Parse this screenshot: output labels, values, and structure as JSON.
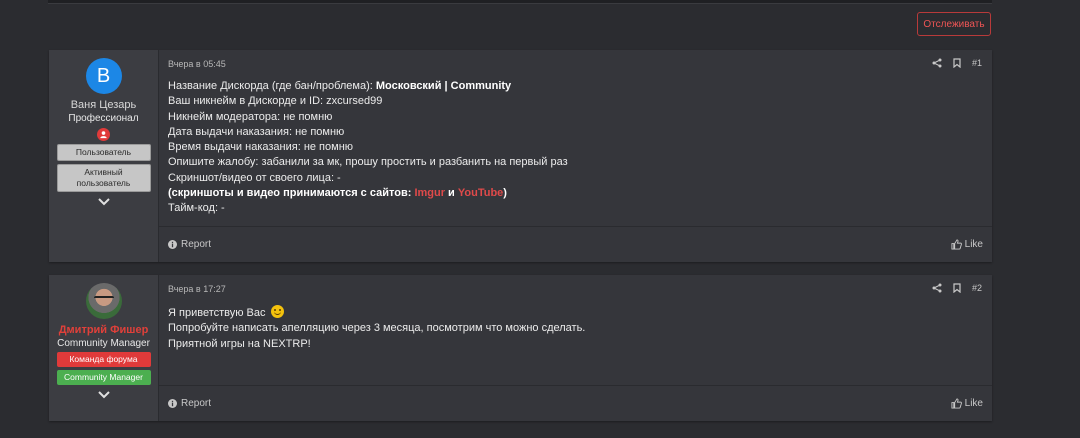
{
  "thread": {
    "watch_label": "Отслеживать"
  },
  "posts": [
    {
      "user": {
        "avatar_letter": "B",
        "name": "Ваня Цезарь",
        "title": "Профессионал",
        "badges": [
          "Пользователь",
          "Активный пользователь"
        ]
      },
      "date": "Вчера в 05:45",
      "number": "#1",
      "lines": [
        {
          "label": "Название Дискорда (где бан/проблема): ",
          "value": "Московский | Community"
        },
        {
          "text": "Ваш никнейм в Дискорде и ID: zxcursed99"
        },
        {
          "text": "Никнейм модератора: не помню"
        },
        {
          "text": "Дата выдачи наказания: не помню"
        },
        {
          "text": "Время выдачи наказания: не помню"
        },
        {
          "text": "Опишите жалобу: забанили за мк, прошу простить и разбанить на первый раз"
        },
        {
          "text": "Скриншот/видео от своего лица: -"
        },
        {
          "bold_prefix": "(скриншоты и видео принимаются с сайтов: ",
          "link1": "Imgur",
          "mid": " и ",
          "link2": "YouTube",
          "suffix": ")"
        },
        {
          "text": "Тайм-код: -"
        }
      ],
      "report_label": "Report",
      "like_label": "Like"
    },
    {
      "user": {
        "name": "Дмитрий Фишер",
        "title": "Community Manager",
        "badges": [
          "Команда форума",
          "Community Manager"
        ]
      },
      "date": "Вчера в 17:27",
      "number": "#2",
      "lines": [
        {
          "text": "Я приветствую Вас "
        },
        {
          "text": "Попробуйте написать апелляцию через 3 месяца, посмотрим что можно сделать."
        },
        {
          "text": "Приятной игры на NEXTRP!"
        }
      ],
      "report_label": "Report",
      "like_label": "Like"
    }
  ],
  "icons": [
    "share-icon",
    "bookmark-icon",
    "info-icon",
    "thumbs-up-icon",
    "chevron-down-icon",
    "smile-emoji-icon",
    "rank-user-icon"
  ],
  "colors": {
    "accent_red": "#e03a3a",
    "avatar_blue": "#1c87e6",
    "green_badge": "#4caf50"
  }
}
